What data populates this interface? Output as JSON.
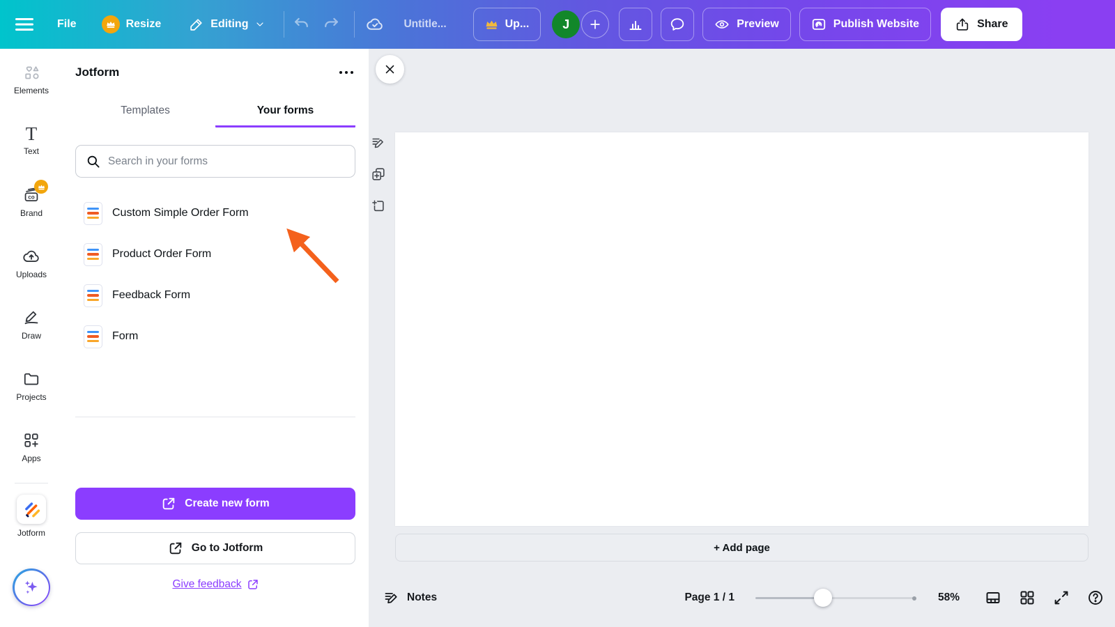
{
  "header": {
    "file_label": "File",
    "resize_label": "Resize",
    "editing_label": "Editing",
    "doc_title": "Untitle...",
    "upgrade_label": "Up...",
    "avatar_initial": "J",
    "preview_label": "Preview",
    "publish_label": "Publish Website",
    "share_label": "Share"
  },
  "sidebar": {
    "items": [
      {
        "label": "Elements"
      },
      {
        "label": "Text"
      },
      {
        "label": "Brand",
        "pro": true
      },
      {
        "label": "Uploads"
      },
      {
        "label": "Draw"
      },
      {
        "label": "Projects"
      },
      {
        "label": "Apps"
      }
    ],
    "app_label": "Jotform"
  },
  "panel": {
    "title": "Jotform",
    "tabs": {
      "templates": "Templates",
      "your_forms": "Your forms"
    },
    "active_tab": "Your forms",
    "search_placeholder": "Search in your forms",
    "search_value": "",
    "forms": [
      {
        "label": "Custom Simple Order Form"
      },
      {
        "label": "Product Order Form"
      },
      {
        "label": "Feedback Form"
      },
      {
        "label": "Form"
      }
    ],
    "create_button": "Create new form",
    "goto_button": "Go to Jotform",
    "feedback_link": "Give feedback"
  },
  "canvas": {
    "add_page_label": "+ Add page",
    "page_count_shown": 1
  },
  "statusbar": {
    "notes_label": "Notes",
    "page_indicator": "Page 1 / 1",
    "zoom_value": "58%",
    "zoom_percent": 58
  },
  "icons": {
    "more_options": "three-dots",
    "menu": "hamburger",
    "upgrade": "crown",
    "sync": "cloud-check",
    "publish": "browser-swirl",
    "share": "upload-tray",
    "assistant": "magic-sparkles"
  },
  "colors": {
    "accent_purple": "#8b3dff",
    "annotation_arrow_orange": "#f4611c",
    "avatar_green": "#12872a",
    "crown_gold": "#f2a60d",
    "header_gradient_left": "#00c4cc",
    "header_gradient_right": "#8a3ff2",
    "canvas_bg": "#ebedf1",
    "form_icon_blue": "#3f94f8",
    "form_icon_orange": "#ef5b24",
    "form_icon_amber": "#f9a62a"
  }
}
